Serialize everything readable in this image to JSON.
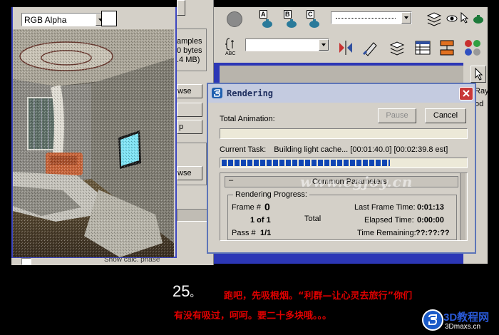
{
  "frame_window": {
    "channel_value": "RGB Alpha"
  },
  "settings_panel": {
    "info_lines": [
      "amples",
      "0 bytes",
      ".4 MB)"
    ],
    "btn_browse1": "wse",
    "btn_stub": "p",
    "btn_browse2": "wse",
    "status_text": "Show calc. phase"
  },
  "toolbar": {
    "abc_label": "ABC",
    "letters": [
      "A",
      "B",
      "C"
    ]
  },
  "right_strip": [
    "Ray",
    "od"
  ],
  "dialog": {
    "title": "Rendering",
    "total_animation_label": "Total Animation:",
    "pause_label": "Pause",
    "cancel_label": "Cancel",
    "current_task_label": "Current Task:",
    "current_task_text": "Building light cache... [00:01:40.0] [00:02:39.8 est]",
    "task_progress": 0.69,
    "rollout_title": "Common Parameters",
    "progress_group_title": "Rendering Progress:",
    "frame_label": "Frame #",
    "frame_value": "0",
    "of_value": "1 of 1",
    "total_label": "Total",
    "pass_label": "Pass #",
    "pass_value": "1/1",
    "last_frame_label": "Last Frame Time:",
    "last_frame_value": "0:01:13",
    "elapsed_label": "Elapsed Time:",
    "elapsed_value": "0:00:00",
    "remaining_label": "Time Remaining:",
    "remaining_value": "??:??:??"
  },
  "watermark": "www.cgjoy.cn",
  "caption": {
    "number": "25",
    "dot": "。",
    "line1": "跑吧，先吸根烟。“利群—让心灵去旅行”你们",
    "line2": "有没有吸过，呵呵。要二十多块哦。。。"
  },
  "logo": {
    "text": "3D教程网",
    "url": "3Dmaxs.cn"
  },
  "colors": {
    "desktop_blue": "#2c37b6",
    "title_bar": "#5d75b8",
    "progress_blue": "#1046b4",
    "caption_red": "#e00000",
    "close_red": "#c83838"
  }
}
